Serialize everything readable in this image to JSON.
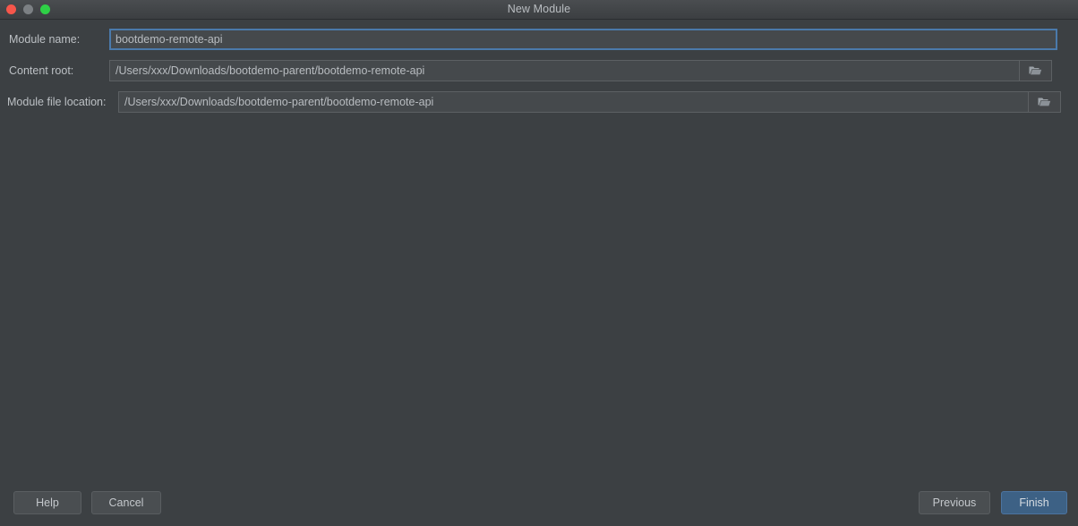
{
  "window": {
    "title": "New Module",
    "controls": {
      "close": "close-button",
      "minimize": "minimize-button",
      "maximize": "maximize-button"
    }
  },
  "form": {
    "fields": [
      {
        "label": "Module name:",
        "value": "bootdemo-remote-api",
        "focused": true,
        "has_browse": false
      },
      {
        "label": "Content root:",
        "value": "/Users/xxx/Downloads/bootdemo-parent/bootdemo-remote-api",
        "focused": false,
        "has_browse": true,
        "browse_icon": "folder-icon"
      },
      {
        "label": "Module file location:",
        "value": "/Users/xxx/Downloads/bootdemo-parent/bootdemo-remote-api",
        "focused": false,
        "has_browse": true,
        "browse_icon": "folder-icon"
      }
    ]
  },
  "footer": {
    "help_label": "Help",
    "cancel_label": "Cancel",
    "previous_label": "Previous",
    "finish_label": "Finish"
  },
  "colors": {
    "background": "#3c4043",
    "titlebar": "#434649",
    "field_bg": "#45494c",
    "field_border": "#5c6063",
    "focus_border": "#4b7aab",
    "text": "#bcc0c4",
    "accent": "#3d6185",
    "close": "#f6564b",
    "minimize": "#7c8084",
    "maximize": "#2ed046"
  }
}
